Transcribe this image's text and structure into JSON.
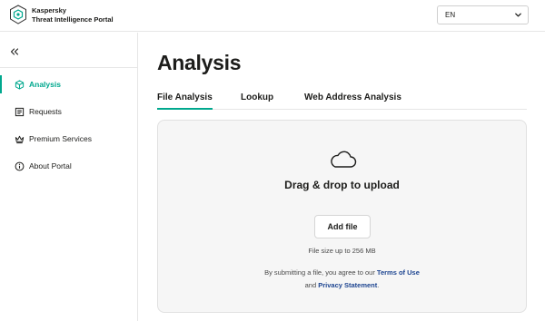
{
  "header": {
    "brand_line1": "Kaspersky",
    "brand_line2": "Threat Intelligence Portal",
    "language": "EN",
    "logo_icon": "kaspersky-shield-icon"
  },
  "sidebar": {
    "collapse_icon": "double-chevron-left-icon",
    "items": [
      {
        "label": "Analysis",
        "icon": "cube-icon",
        "active": true
      },
      {
        "label": "Requests",
        "icon": "document-list-icon",
        "active": false
      },
      {
        "label": "Premium Services",
        "icon": "crown-icon",
        "active": false
      },
      {
        "label": "About Portal",
        "icon": "info-icon",
        "active": false
      }
    ]
  },
  "main": {
    "title": "Analysis",
    "tabs": [
      {
        "label": "File Analysis",
        "active": true
      },
      {
        "label": "Lookup",
        "active": false
      },
      {
        "label": "Web Address Analysis",
        "active": false
      }
    ],
    "dropzone": {
      "icon": "cloud-icon",
      "title": "Drag & drop to upload",
      "button": "Add file",
      "size_note": "File size up to 256 MB",
      "legal_prefix": "By submitting a file, you agree to our",
      "terms_link": "Terms of Use",
      "legal_and": "and",
      "privacy_link": "Privacy Statement",
      "legal_suffix": "."
    }
  },
  "colors": {
    "accent": "#00a88e",
    "link": "#1c4490",
    "dropzone_bg": "#f6f6f6"
  }
}
